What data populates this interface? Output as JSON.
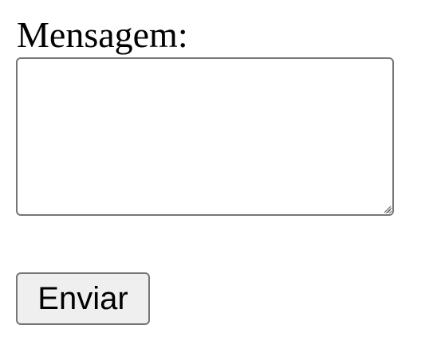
{
  "form": {
    "label": "Mensagem:",
    "message_value": "",
    "submit_label": "Enviar"
  }
}
